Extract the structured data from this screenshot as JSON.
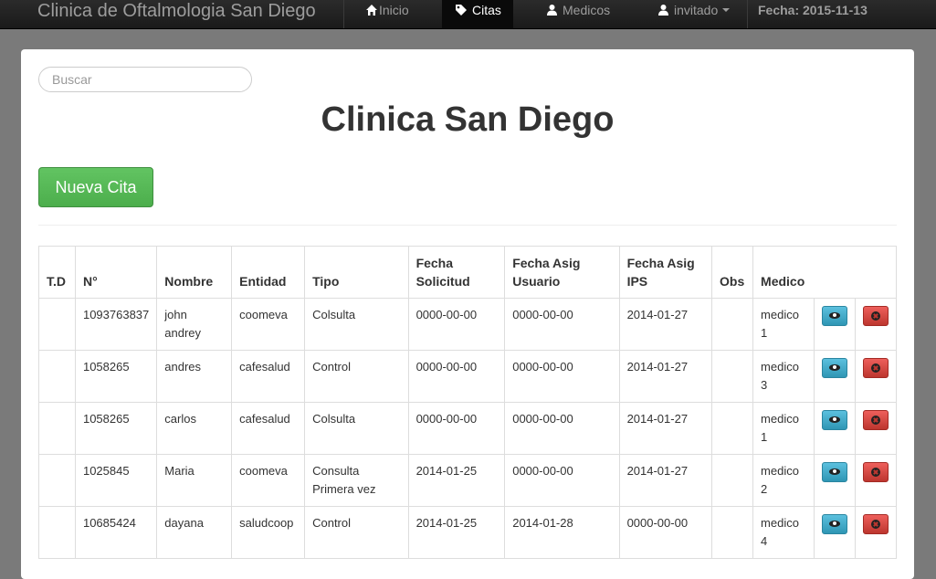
{
  "navbar": {
    "brand": "Clinica de Oftalmologia San Diego",
    "items": [
      {
        "label": "Inicio",
        "icon": "home-icon"
      },
      {
        "label": "Citas",
        "icon": "tags-icon",
        "active": true
      },
      {
        "label": "Medicos",
        "icon": "user-icon"
      },
      {
        "label": "invitado",
        "icon": "user-icon"
      }
    ],
    "date": "Fecha: 2015-11-13"
  },
  "search": {
    "placeholder": "Buscar"
  },
  "page_title": "Clinica San Diego",
  "new_button": "Nueva Cita",
  "table": {
    "headers": [
      "T.D",
      "N°",
      "Nombre",
      "Entidad",
      "Tipo",
      "Fecha Solicitud",
      "Fecha Asig Usuario",
      "Fecha Asig IPS",
      "Obs",
      "Medico"
    ],
    "rows": [
      {
        "td": "",
        "num": "1093763837",
        "nombre": "john andrey",
        "entidad": "coomeva",
        "tipo": "Colsulta",
        "fecha_solicitud": "0000-00-00",
        "fecha_usuario": "0000-00-00",
        "fecha_ips": "2014-01-27",
        "obs": "",
        "medico": "medico 1"
      },
      {
        "td": "",
        "num": "1058265",
        "nombre": "andres",
        "entidad": "cafesalud",
        "tipo": "Control",
        "fecha_solicitud": "0000-00-00",
        "fecha_usuario": "0000-00-00",
        "fecha_ips": "2014-01-27",
        "obs": "",
        "medico": "medico 3"
      },
      {
        "td": "",
        "num": "1058265",
        "nombre": "carlos",
        "entidad": "cafesalud",
        "tipo": "Colsulta",
        "fecha_solicitud": "0000-00-00",
        "fecha_usuario": "0000-00-00",
        "fecha_ips": "2014-01-27",
        "obs": "",
        "medico": "medico 1"
      },
      {
        "td": "",
        "num": "1025845",
        "nombre": "Maria",
        "entidad": "coomeva",
        "tipo": "Consulta Primera vez",
        "fecha_solicitud": "2014-01-25",
        "fecha_usuario": "0000-00-00",
        "fecha_ips": "2014-01-27",
        "obs": "",
        "medico": "medico 2"
      },
      {
        "td": "",
        "num": "10685424",
        "nombre": "dayana",
        "entidad": "saludcoop",
        "tipo": "Control",
        "fecha_solicitud": "2014-01-25",
        "fecha_usuario": "2014-01-28",
        "fecha_ips": "0000-00-00",
        "obs": "",
        "medico": "medico 4"
      }
    ]
  },
  "colors": {
    "navbar": "#222222",
    "success": "#5cb85c",
    "info": "#5bc0de",
    "danger": "#d9534f"
  }
}
